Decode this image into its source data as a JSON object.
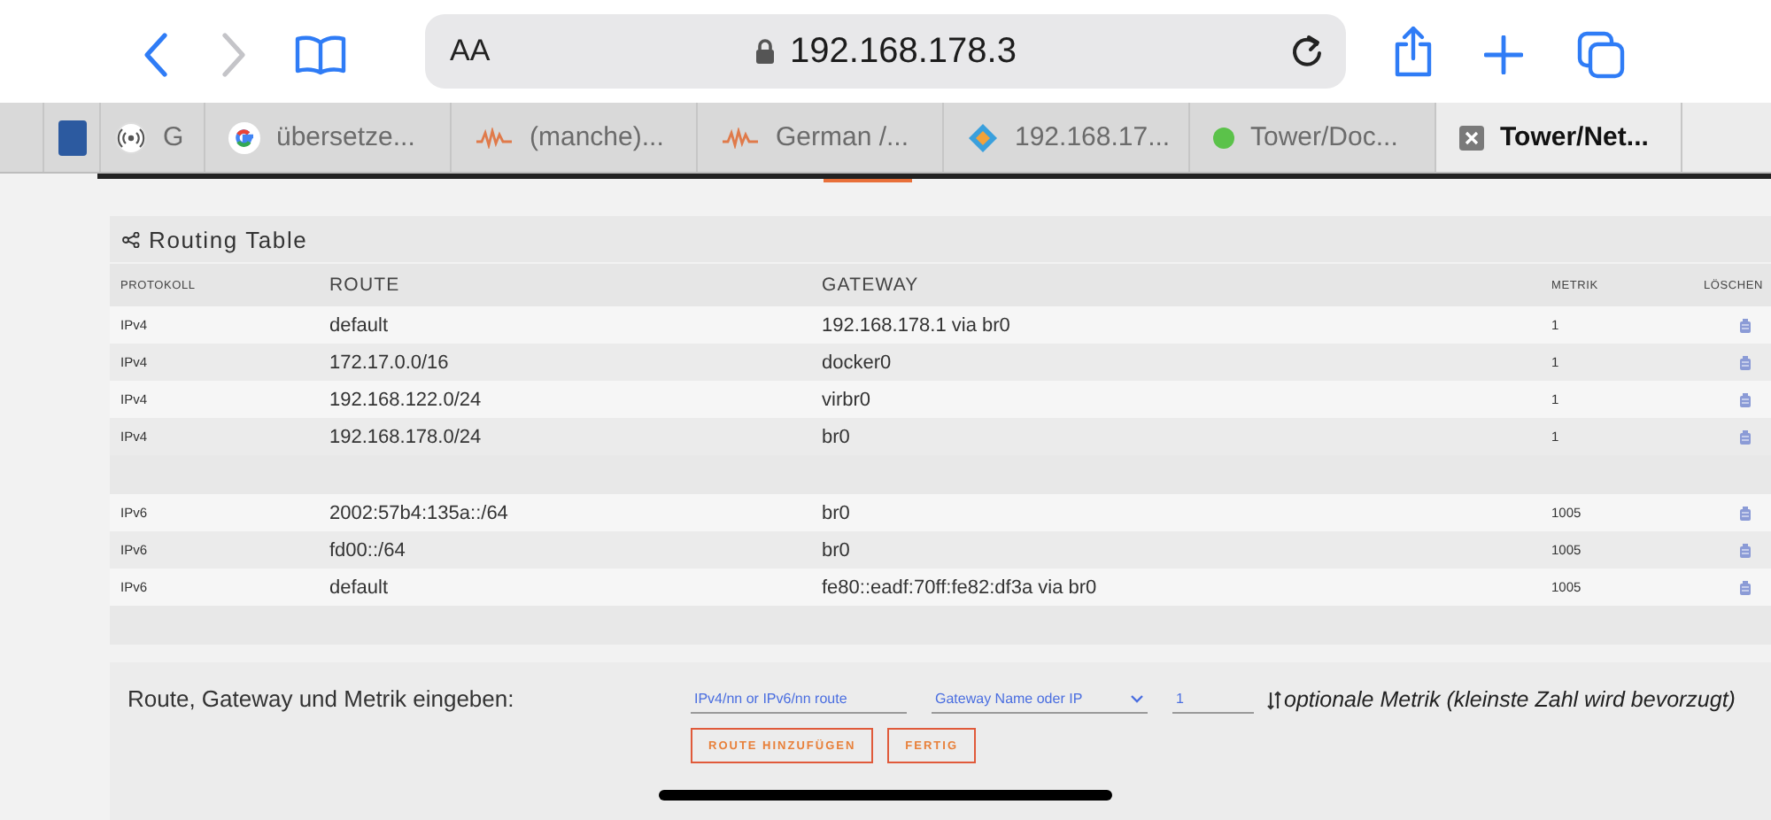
{
  "browser": {
    "text_size": "AA",
    "address": "192.168.178.3",
    "tabs": [
      {
        "kind": "square",
        "selected": false
      },
      {
        "label": "G",
        "kind": "radio",
        "selected": false
      },
      {
        "label": "übersetze...",
        "kind": "google",
        "selected": false
      },
      {
        "label": "(manche)...",
        "kind": "wave",
        "selected": false
      },
      {
        "label": "German /...",
        "kind": "wave",
        "selected": false
      },
      {
        "label": "192.168.17...",
        "kind": "diamond",
        "selected": false
      },
      {
        "label": "Tower/Doc...",
        "kind": "dot",
        "selected": false
      },
      {
        "label": "Tower/Net...",
        "kind": "close",
        "selected": true
      }
    ]
  },
  "routing_table": {
    "title": "Routing Table",
    "columns": [
      "PROTOKOLL",
      "ROUTE",
      "GATEWAY",
      "METRIK",
      "LÖSCHEN"
    ],
    "groups": [
      [
        {
          "protocol": "IPv4",
          "route": "default",
          "gateway": "192.168.178.1 via br0",
          "metric": "1"
        },
        {
          "protocol": "IPv4",
          "route": "172.17.0.0/16",
          "gateway": "docker0",
          "metric": "1"
        },
        {
          "protocol": "IPv4",
          "route": "192.168.122.0/24",
          "gateway": "virbr0",
          "metric": "1"
        },
        {
          "protocol": "IPv4",
          "route": "192.168.178.0/24",
          "gateway": "br0",
          "metric": "1"
        }
      ],
      [
        {
          "protocol": "IPv6",
          "route": "2002:57b4:135a::/64",
          "gateway": "br0",
          "metric": "1005"
        },
        {
          "protocol": "IPv6",
          "route": "fd00::/64",
          "gateway": "br0",
          "metric": "1005"
        },
        {
          "protocol": "IPv6",
          "route": "default",
          "gateway": "fe80::eadf:70ff:fe82:df3a via br0",
          "metric": "1005"
        }
      ]
    ]
  },
  "add_route": {
    "label": "Route, Gateway und Metrik eingeben:",
    "route_field": {
      "placeholder": "IPv4/nn or IPv6/nn route"
    },
    "gateway_select": {
      "placeholder": "Gateway Name oder IP"
    },
    "metric_field": {
      "value": "1"
    },
    "hint": "optionale Metrik (kleinste Zahl wird bevorzugt)",
    "buttons": [
      "ROUTE HINZUFÜGEN",
      "FERTIG"
    ]
  }
}
